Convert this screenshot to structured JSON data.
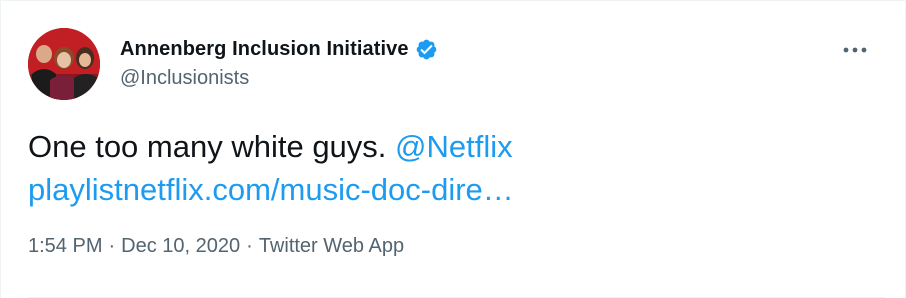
{
  "tweet": {
    "author": {
      "display_name": "Annenberg Inclusion Initiative",
      "handle": "@Inclusionists",
      "verified": true
    },
    "text_prefix": "One too many white guys. ",
    "mention": "@Netflix",
    "link": "playlistnetflix.com/music-doc-dire…",
    "time": "1:54 PM",
    "separator": "·",
    "date": "Dec 10, 2020",
    "source": "Twitter Web App",
    "more_icon": "ellipsis-icon"
  },
  "colors": {
    "text": "#0f1419",
    "secondary": "#536471",
    "accent": "#1d9bf0",
    "avatar_background": "#c21f24"
  }
}
